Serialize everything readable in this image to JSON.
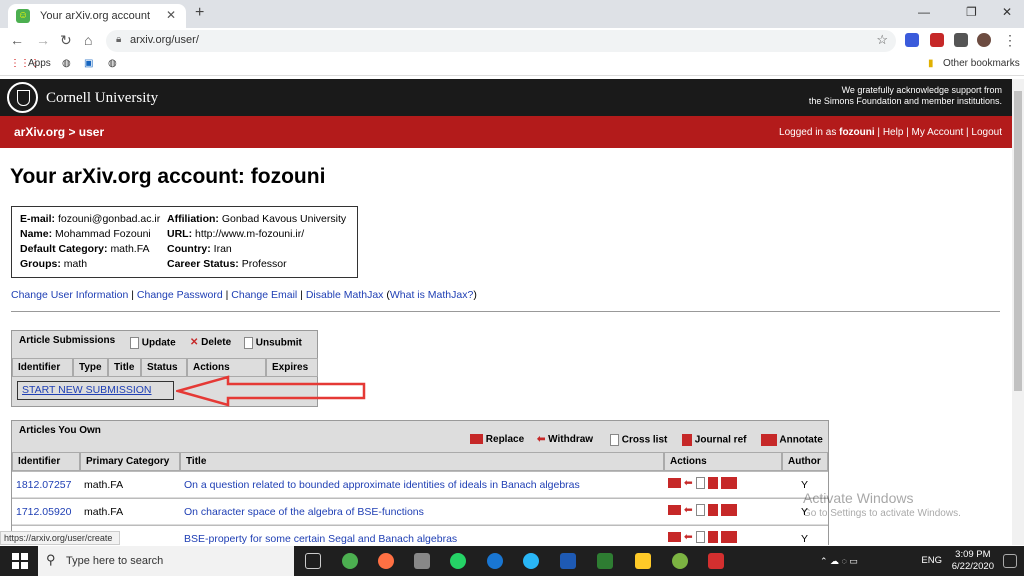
{
  "browser": {
    "tab_title": "Your arXiv.org account",
    "url": "arxiv.org/user/",
    "bookmarks": {
      "apps": "Apps",
      "other": "Other bookmarks"
    }
  },
  "header": {
    "university": "Cornell University",
    "ack_line1": "We gratefully acknowledge support from",
    "ack_line2": "the Simons Foundation and member institutions.",
    "breadcrumb": "arXiv.org > user",
    "logged_in_prefix": "Logged in as ",
    "username": "fozouni",
    "help": "Help",
    "my_account": "My Account",
    "logout": "Logout"
  },
  "page_title": "Your arXiv.org account: fozouni",
  "account": {
    "email_label": "E-mail:",
    "email": "fozouni@gonbad.ac.ir",
    "name_label": "Name:",
    "name": "Mohammad Fozouni",
    "category_label": "Default Category:",
    "category": "math.FA",
    "groups_label": "Groups:",
    "groups": "math",
    "affiliation_label": "Affiliation:",
    "affiliation": "Gonbad Kavous University",
    "url_label": "URL:",
    "url": "http://www.m-fozouni.ir/",
    "country_label": "Country:",
    "country": "Iran",
    "career_label": "Career Status:",
    "career": "Professor"
  },
  "account_links": {
    "change_info": "Change User Information",
    "change_password": "Change Password",
    "change_email": "Change Email",
    "disable_mathjax": "Disable MathJax",
    "what_mathjax": "What is MathJax?"
  },
  "submissions": {
    "title": "Article Submissions",
    "update": "Update",
    "delete": "Delete",
    "unsubmit": "Unsubmit",
    "columns": [
      "Identifier",
      "Type",
      "Title",
      "Status",
      "Actions",
      "Expires"
    ],
    "start_new": "START NEW SUBMISSION"
  },
  "owned": {
    "title": "Articles You Own",
    "replace": "Replace",
    "withdraw": "Withdraw",
    "crosslist": "Cross list",
    "journalref": "Journal ref",
    "annotate": "Annotate",
    "columns": [
      "Identifier",
      "Primary Category",
      "Title",
      "Actions",
      "Author"
    ],
    "rows": [
      {
        "id": "1812.07257",
        "cat": "math.FA",
        "title": "On a question related to bounded approximate identities of ideals in Banach algebras",
        "author": "Y"
      },
      {
        "id": "1712.05920",
        "cat": "math.FA",
        "title": "On character space of the algebra of BSE-functions",
        "author": "Y"
      },
      {
        "id": "",
        "cat": "",
        "title": "BSE-property for some certain Segal and Banach algebras",
        "author": "Y"
      }
    ]
  },
  "status_url": "https://arxiv.org/user/create",
  "watermark": {
    "line1": "Activate Windows",
    "line2": "Go to Settings to activate Windows."
  },
  "taskbar": {
    "search": "Type here to search",
    "lang": "ENG",
    "time": "3:09 PM",
    "date": "6/22/2020"
  }
}
